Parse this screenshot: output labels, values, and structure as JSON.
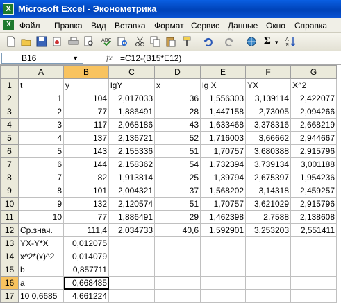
{
  "window": {
    "title": "Microsoft Excel - Эконометрика"
  },
  "menu": [
    "Файл",
    "Правка",
    "Вид",
    "Вставка",
    "Формат",
    "Сервис",
    "Данные",
    "Окно",
    "Справка"
  ],
  "toolbar": {
    "icons": [
      "new-icon",
      "open-icon",
      "save-icon",
      "permission-icon",
      "print-icon",
      "print-preview-icon",
      "spelling-icon",
      "research-icon",
      "cut-icon",
      "copy-icon",
      "paste-icon",
      "format-painter-icon",
      "undo-icon",
      "redo-icon",
      "hyperlink-icon",
      "autosum-icon",
      "sort-icon"
    ]
  },
  "formula_bar": {
    "cell_ref": "B16",
    "fx": "fx",
    "formula": "=C12-(B15*E12)"
  },
  "columns": [
    "A",
    "B",
    "C",
    "D",
    "E",
    "F",
    "G"
  ],
  "active_cell": "B16",
  "rows": [
    {
      "num": "1",
      "cells": [
        "t",
        "y",
        "lgY",
        "x",
        "lg X",
        "YX",
        "X^2"
      ]
    },
    {
      "num": "2",
      "cells": [
        "1",
        "104",
        "2,017033",
        "36",
        "1,556303",
        "3,139114",
        "2,422077"
      ]
    },
    {
      "num": "3",
      "cells": [
        "2",
        "77",
        "1,886491",
        "28",
        "1,447158",
        "2,73005",
        "2,094266"
      ]
    },
    {
      "num": "4",
      "cells": [
        "3",
        "117",
        "2,068186",
        "43",
        "1,633468",
        "3,378316",
        "2,668219"
      ]
    },
    {
      "num": "5",
      "cells": [
        "4",
        "137",
        "2,136721",
        "52",
        "1,716003",
        "3,66662",
        "2,944667"
      ]
    },
    {
      "num": "6",
      "cells": [
        "5",
        "143",
        "2,155336",
        "51",
        "1,70757",
        "3,680388",
        "2,915796"
      ]
    },
    {
      "num": "7",
      "cells": [
        "6",
        "144",
        "2,158362",
        "54",
        "1,732394",
        "3,739134",
        "3,001188"
      ]
    },
    {
      "num": "8",
      "cells": [
        "7",
        "82",
        "1,913814",
        "25",
        "1,39794",
        "2,675397",
        "1,954236"
      ]
    },
    {
      "num": "9",
      "cells": [
        "8",
        "101",
        "2,004321",
        "37",
        "1,568202",
        "3,14318",
        "2,459257"
      ]
    },
    {
      "num": "10",
      "cells": [
        "9",
        "132",
        "2,120574",
        "51",
        "1,70757",
        "3,621029",
        "2,915796"
      ]
    },
    {
      "num": "11",
      "cells": [
        "10",
        "77",
        "1,886491",
        "29",
        "1,462398",
        "2,7588",
        "2,138608"
      ]
    },
    {
      "num": "12",
      "cells": [
        "Ср.знач.",
        "111,4",
        "2,034733",
        "40,6",
        "1,592901",
        "3,253203",
        "2,551411"
      ]
    },
    {
      "num": "13",
      "cells": [
        "YX-Y*X",
        "0,012075",
        "",
        "",
        "",
        "",
        ""
      ]
    },
    {
      "num": "14",
      "cells": [
        "x^2*(x)^2",
        "0,014079",
        "",
        "",
        "",
        "",
        ""
      ]
    },
    {
      "num": "15",
      "cells": [
        "b",
        "0,857711",
        "",
        "",
        "",
        "",
        ""
      ]
    },
    {
      "num": "16",
      "cells": [
        "a",
        "0,668485",
        "",
        "",
        "",
        "",
        ""
      ]
    },
    {
      "num": "17",
      "cells": [
        "10 0,6685",
        "4,661224",
        "",
        "",
        "",
        "",
        ""
      ]
    }
  ]
}
